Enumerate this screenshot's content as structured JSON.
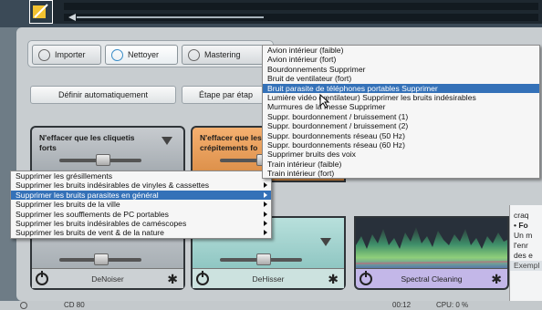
{
  "tabs": [
    {
      "label": "Importer",
      "active": false
    },
    {
      "label": "Nettoyer",
      "active": true
    },
    {
      "label": "Mastering",
      "active": false
    }
  ],
  "auto_row": {
    "define_auto": "Définir automatiquement",
    "step_by_step": "Étape par étap"
  },
  "modules": {
    "module1_text": "N'effacer que les cliquetis forts",
    "module2_text": "N'effacer que les crépitements fo",
    "denoiser": "DeNoiser",
    "dehisser": "DeHisser",
    "spectral": "Spectral Cleaning"
  },
  "submenu": {
    "items": [
      {
        "label": "Supprimer les grésillements",
        "highlighted": false
      },
      {
        "label": "Supprimer les bruits indésirables de vinyles & cassettes",
        "highlighted": false
      },
      {
        "label": "Supprimer les bruits parasites en général",
        "highlighted": true
      },
      {
        "label": "Supprimer les bruits de la ville",
        "highlighted": false
      },
      {
        "label": "Supprimer les soufflements de PC portables",
        "highlighted": false
      },
      {
        "label": "Supprimer les bruits indésirables de caméscopes",
        "highlighted": false
      },
      {
        "label": "Supprimer les bruits de vent & de la nature",
        "highlighted": false
      }
    ]
  },
  "flyout": {
    "items": [
      {
        "label": "Avion intérieur (faible)",
        "highlighted": false
      },
      {
        "label": "Avion intérieur (fort)",
        "highlighted": false
      },
      {
        "label": "Bourdonnements Supprimer",
        "highlighted": false
      },
      {
        "label": "Bruit de ventilateur (fort)",
        "highlighted": false
      },
      {
        "label": "Bruit parasite de téléphones portables Supprimer",
        "highlighted": true
      },
      {
        "label": "Lumière vidéo (ventilateur) Supprimer les bruits indésirables",
        "highlighted": false
      },
      {
        "label": "Murmures de la messe Supprimer",
        "highlighted": false
      },
      {
        "label": "Suppr. bourdonnement / bruissement (1)",
        "highlighted": false
      },
      {
        "label": "Suppr. bourdonnement / bruissement (2)",
        "highlighted": false
      },
      {
        "label": "Suppr. bourdonnements réseau (50 Hz)",
        "highlighted": false
      },
      {
        "label": "Suppr. bourdonnements réseau (60 Hz)",
        "highlighted": false
      },
      {
        "label": "Supprimer bruits des voix",
        "highlighted": false
      },
      {
        "label": "Train intérieur (faible)",
        "highlighted": false
      },
      {
        "label": "Train intérieur (fort)",
        "highlighted": false
      }
    ]
  },
  "right_pane": {
    "lines": [
      "craq",
      "",
      "• Fo",
      "Un m",
      "l'enr",
      "des e",
      "Exempl"
    ]
  },
  "status": {
    "left": "CD 80",
    "time": "00:12",
    "cpu": "CPU: 0 %"
  }
}
